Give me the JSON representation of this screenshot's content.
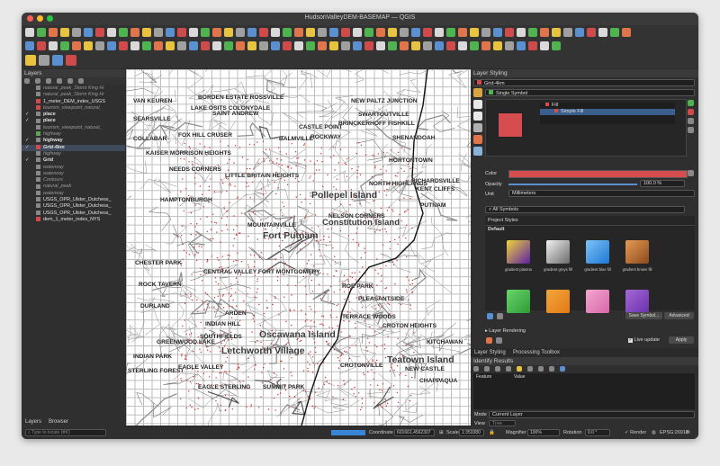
{
  "window": {
    "title": "HudsonValleyDEM-BASEMAP — QGIS"
  },
  "layers_panel": {
    "title": "Layers",
    "items": [
      {
        "label": "natural_peak_Storm King Hi",
        "checked": false,
        "color": "",
        "bold": false,
        "italic": true
      },
      {
        "label": "natural_peak_Storm King Hi",
        "checked": false,
        "color": "",
        "bold": false,
        "italic": true
      },
      {
        "label": "1_meter_DEM_index_USGS",
        "checked": false,
        "color": "#cf4b4b",
        "bold": false,
        "italic": false
      },
      {
        "label": "tourism_viewpoint_natural_",
        "checked": false,
        "color": "#cf4b4b",
        "bold": false,
        "italic": true
      },
      {
        "label": "place",
        "checked": true,
        "color": "",
        "bold": true,
        "italic": false
      },
      {
        "label": "place",
        "checked": true,
        "color": "",
        "bold": true,
        "italic": false
      },
      {
        "label": "tourism_viewpoint_natural_",
        "checked": false,
        "color": "",
        "bold": false,
        "italic": true
      },
      {
        "label": "highway",
        "checked": false,
        "color": "#63a05a",
        "bold": false,
        "italic": true
      },
      {
        "label": "highway",
        "checked": true,
        "color": "",
        "bold": true,
        "italic": false
      },
      {
        "label": "Grid-4km",
        "checked": true,
        "color": "#cf4b4b",
        "bold": true,
        "italic": true
      },
      {
        "label": "highway",
        "checked": false,
        "color": "",
        "bold": false,
        "italic": true
      },
      {
        "label": "Grid",
        "checked": true,
        "color": "",
        "bold": true,
        "italic": false
      },
      {
        "label": "waterway",
        "checked": false,
        "color": "",
        "bold": false,
        "italic": true
      },
      {
        "label": "waterway",
        "checked": false,
        "color": "",
        "bold": false,
        "italic": true
      },
      {
        "label": "Contours",
        "checked": false,
        "color": "",
        "bold": false,
        "italic": true
      },
      {
        "label": "natural_peak",
        "checked": false,
        "color": "",
        "bold": false,
        "italic": true
      },
      {
        "label": "waterway",
        "checked": false,
        "color": "",
        "bold": false,
        "italic": true
      },
      {
        "label": "USGS_OPR_Ulster_Dutchess_",
        "checked": false,
        "color": "",
        "bold": false,
        "italic": false
      },
      {
        "label": "USGS_OPR_Ulster_Dutchess_",
        "checked": false,
        "color": "",
        "bold": false,
        "italic": false
      },
      {
        "label": "USGS_OPR_Ulster_Dutchess_",
        "checked": false,
        "color": "",
        "bold": false,
        "italic": false
      },
      {
        "label": "dem_1_meter_index_NYS",
        "checked": false,
        "color": "#cf4b4b",
        "bold": false,
        "italic": false
      }
    ],
    "bottom_tabs": [
      "Layers",
      "Browser"
    ]
  },
  "styling_panel": {
    "title": "Layer Styling",
    "layer_select": "Grid-4km",
    "renderer": "Single Symbol",
    "tree": [
      "Fill",
      "Simple Fill"
    ],
    "color_label": "Color",
    "fill_color": "#d64d4f",
    "opacity_label": "Opacity",
    "opacity_value": "100.0 %",
    "opacity": 1.0,
    "unit_label": "Unit",
    "unit_value": "Millimeters",
    "search_placeholder": "All Symbols",
    "project_styles": "Project Styles",
    "default_label": "Default",
    "gradients": [
      {
        "label": "gradient  plasma",
        "from": "#f0d438",
        "to": "#5c1fa8"
      },
      {
        "label": "gradient  greys fill",
        "from": "#f2f2f2",
        "to": "#6a6a6a"
      },
      {
        "label": "gradient blue fill",
        "from": "#7ec3f5",
        "to": "#1c78d6"
      },
      {
        "label": "gradient brown fill",
        "from": "#e89a55",
        "to": "#8a4a1c"
      },
      {
        "label": "",
        "from": "#66d66a",
        "to": "#2f9a36"
      },
      {
        "label": "",
        "from": "#f3a540",
        "to": "#e27a12"
      },
      {
        "label": "",
        "from": "#f2a7d0",
        "to": "#d865a8"
      },
      {
        "label": "",
        "from": "#a46ad6",
        "to": "#6a2fae"
      }
    ],
    "save_symbol": "Save Symbol...",
    "advanced": "Advanced",
    "layer_rendering": "Layer Rendering",
    "live_update": "Live update",
    "apply": "Apply",
    "tabs": [
      "Layer Styling",
      "Processing Toolbox"
    ]
  },
  "identify_panel": {
    "title": "Identify Results",
    "columns": [
      "Feature",
      "Value"
    ],
    "mode_label": "Mode",
    "mode_value": "Current Layer",
    "view_label": "View",
    "view_value": "Tree"
  },
  "status": {
    "locate_placeholder": "Type to locate (⌘K)",
    "coordinate_label": "Coordinate",
    "coordinate_value": "601661,4562307",
    "scale_label": "Scale",
    "scale_value": "1:353380",
    "magnifier_label": "Magnifier",
    "magnifier_value": "100%",
    "rotation_label": "Rotation",
    "rotation_value": "0.0 °",
    "render_label": "Render",
    "crs": "EPSG:26918"
  },
  "map_labels": [
    {
      "text": "BORDEN ESTATE ROSSVILLE",
      "size": 7
    },
    {
      "text": "VAN KEUREN",
      "size": 7
    },
    {
      "text": "LAKE OSITS COLONYDALE",
      "size": 7
    },
    {
      "text": "SAINT ANDREW",
      "size": 7
    },
    {
      "text": "NEW PALTZ JUNCTION",
      "size": 7
    },
    {
      "text": "SWARTOUTVILLE",
      "size": 7
    },
    {
      "text": "SEARSVILLE",
      "size": 7
    },
    {
      "text": "BRINCKERHOFF FISHKILL",
      "size": 7
    },
    {
      "text": "CASTLE POINT",
      "size": 7
    },
    {
      "text": "FOX HILL CRUSER",
      "size": 7
    },
    {
      "text": "SHENANDOAH",
      "size": 7
    },
    {
      "text": "COLLABAR",
      "size": 7
    },
    {
      "text": "BALMVILLE",
      "size": 7
    },
    {
      "text": "ROCKWAY",
      "size": 7
    },
    {
      "text": "KAISER MORRISON HEIGHTS",
      "size": 7
    },
    {
      "text": "HORTONTOWN",
      "size": 7
    },
    {
      "text": "NEEDS CORNERS",
      "size": 7
    },
    {
      "text": "LITTLE BRITAIN HEIGHTS",
      "size": 7
    },
    {
      "text": "NORTH HIGHLANDS",
      "size": 7
    },
    {
      "text": "RICHARDSVILLE",
      "size": 7
    },
    {
      "text": "KENT CLIFFS",
      "size": 7
    },
    {
      "text": "Pollepel Island",
      "size": 11
    },
    {
      "text": "Constitution Island",
      "size": 10
    },
    {
      "text": "HAMPTONBURGH",
      "size": 7
    },
    {
      "text": "NELSON CORNERS",
      "size": 7
    },
    {
      "text": "PUTNAM",
      "size": 7
    },
    {
      "text": "MOUNTAINVILLE",
      "size": 7
    },
    {
      "text": "Fort Putnam",
      "size": 11
    },
    {
      "text": "CHESTER PARK",
      "size": 7
    },
    {
      "text": "CENTRAL VALLEY FORT MONTGOMERY",
      "size": 7
    },
    {
      "text": "ROCK TAVERN",
      "size": 7
    },
    {
      "text": "ROE PARK",
      "size": 7
    },
    {
      "text": "CROTON HEIGHTS",
      "size": 7
    },
    {
      "text": "DURLAND",
      "size": 7
    },
    {
      "text": "PLEASANTSIDE",
      "size": 7
    },
    {
      "text": "ARDEN",
      "size": 7
    },
    {
      "text": "INDIAN HILL",
      "size": 7
    },
    {
      "text": "TERRACE WOODS",
      "size": 7
    },
    {
      "text": "Oscawana Island",
      "size": 11
    },
    {
      "text": "Letchworth Village",
      "size": 11
    },
    {
      "text": "Teatown Island",
      "size": 11
    },
    {
      "text": "GREENWOOD LAKE",
      "size": 7
    },
    {
      "text": "INDIAN PARK",
      "size": 7
    },
    {
      "text": "STERLING FOREST",
      "size": 7
    },
    {
      "text": "NEW CASTLE",
      "size": 7
    },
    {
      "text": "EAGLE VALLEY",
      "size": 7
    },
    {
      "text": "SOUTHFIELDS",
      "size": 7
    },
    {
      "text": "KITCHAWAN",
      "size": 7
    },
    {
      "text": "CROTONVILLE",
      "size": 7
    },
    {
      "text": "CHAPPAQUA",
      "size": 7
    },
    {
      "text": "SUMMIT PARK",
      "size": 7
    },
    {
      "text": "EAGLE STERLING",
      "size": 7
    }
  ]
}
